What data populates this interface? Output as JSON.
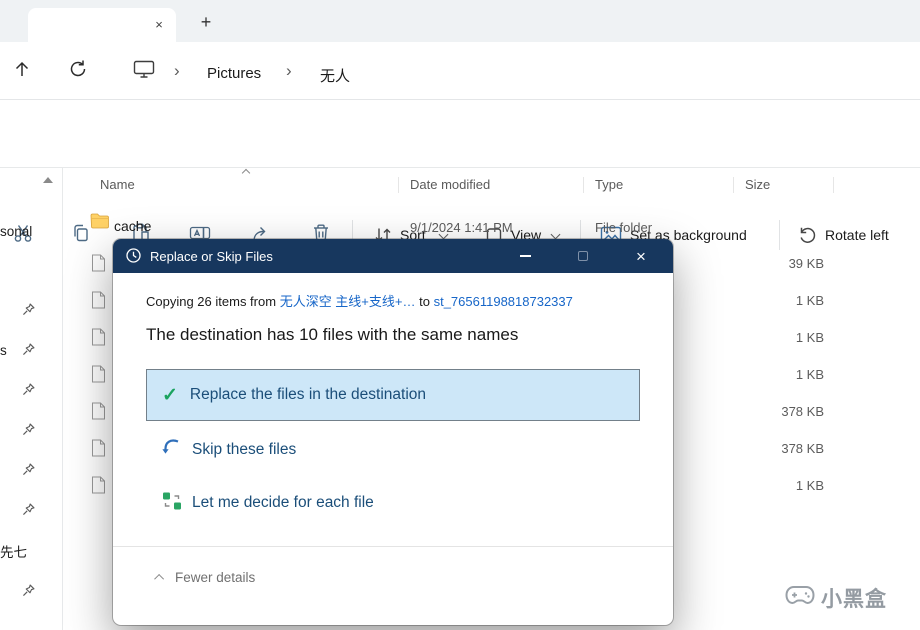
{
  "glyphs": {
    "tab_close": "×",
    "new_tab": "+",
    "breadcrumb_chevron": "›",
    "dialog_close": "×",
    "check": "✓"
  },
  "nav": {
    "breadcrumb": [
      "Pictures",
      "无人"
    ]
  },
  "toolbar": {
    "sort_label": "Sort",
    "view_label": "View",
    "set_background_label": "Set as background",
    "rotate_left_label": "Rotate left"
  },
  "list": {
    "columns": [
      "Name",
      "Date modified",
      "Type",
      "Size"
    ],
    "rows": [
      {
        "name": "cache",
        "date_modified": "9/1/2024 1:41 PM",
        "type": "File folder",
        "size": ""
      },
      {
        "size": "39 KB"
      },
      {
        "size": "1 KB"
      },
      {
        "size": "1 KB"
      },
      {
        "size": "1 KB"
      },
      {
        "size": "378 KB"
      },
      {
        "size": "378 KB"
      },
      {
        "size": "1 KB"
      }
    ]
  },
  "sidebar": {
    "partial_labels": [
      "sonal",
      "s",
      "先七"
    ]
  },
  "dialog": {
    "title": "Replace or Skip Files",
    "copy_prefix": "Copying 26 items from",
    "source_link": "无人深空 主线+支线+…",
    "to_text": "to",
    "dest_link": "st_76561198818732337",
    "headline": "The destination has 10 files with the same names",
    "options": {
      "replace": "Replace the files in the destination",
      "skip": "Skip these files",
      "decide": "Let me decide for each file"
    },
    "fewer_details": "Fewer details"
  },
  "watermark": {
    "text": "小黑盒"
  },
  "colors": {
    "title_bar": "#17375e",
    "selected_option_bg": "#cde7f8",
    "link": "#1766c8",
    "option_text": "#1b4e79"
  }
}
